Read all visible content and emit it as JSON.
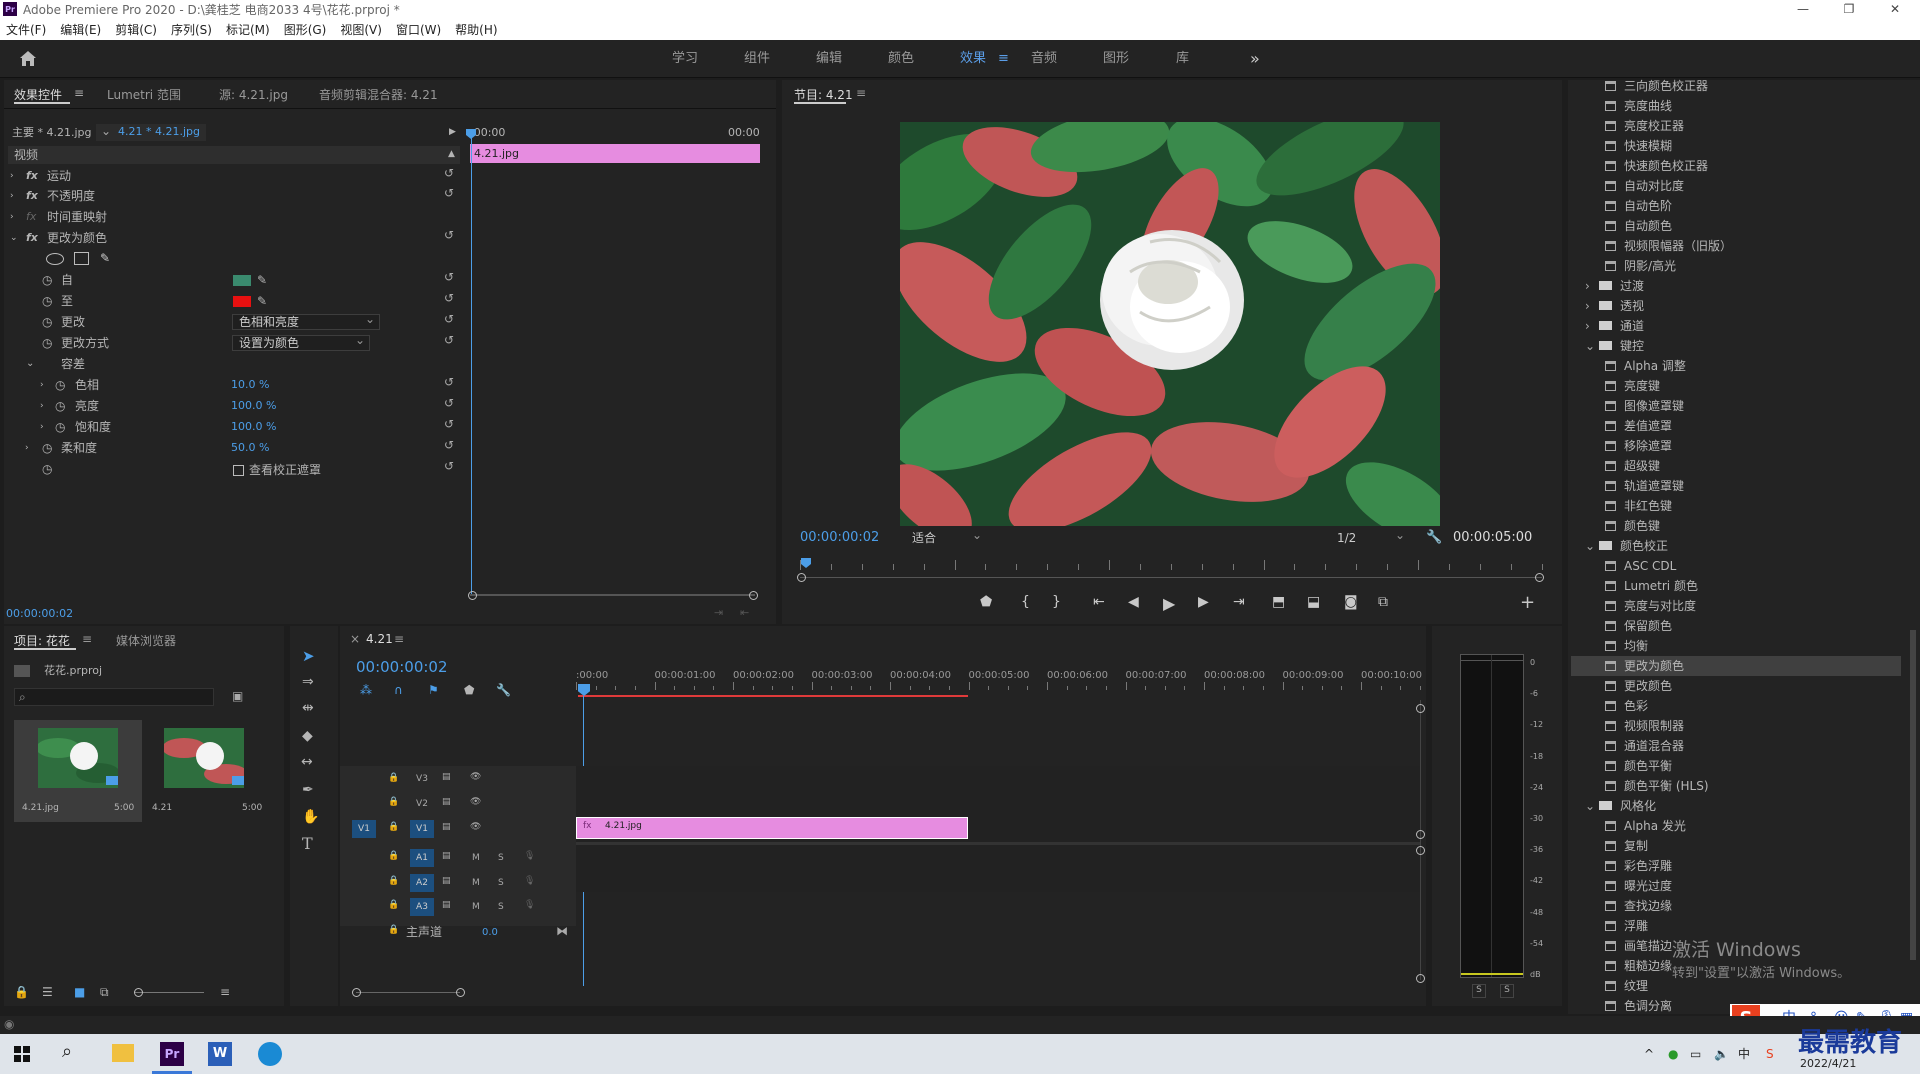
{
  "window": {
    "title": "Adobe Premiere Pro 2020 - D:\\龚桂芝 电商2033 4号\\花花.prproj *",
    "min": "—",
    "max": "❐",
    "close": "✕"
  },
  "menu": [
    "文件(F)",
    "编辑(E)",
    "剪辑(C)",
    "序列(S)",
    "标记(M)",
    "图形(G)",
    "视图(V)",
    "窗口(W)",
    "帮助(H)"
  ],
  "workspaces": [
    "学习",
    "组件",
    "编辑",
    "颜色",
    "效果",
    "音频",
    "图形",
    "库"
  ],
  "active_workspace": "效果",
  "more": "»",
  "effect_controls": {
    "tabs": [
      "效果控件",
      "Lumetri 范围",
      "源: 4.21.jpg",
      "音频剪辑混合器: 4.21"
    ],
    "master": "主要 * 4.21.jpg",
    "clip": "4.21 * 4.21.jpg",
    "ruler_start": ":00:00",
    "ruler_end": "00:00",
    "clip_label": "4.21.jpg",
    "video_header": "视频",
    "fx": [
      "运动",
      "不透明度",
      "时间重映射",
      "更改为颜色"
    ],
    "props": {
      "from": "自",
      "to": "至",
      "change": "更改",
      "change_val": "色相和亮度",
      "by": "更改方式",
      "by_val": "设置为颜色",
      "tolerance": "容差",
      "hue": "色相",
      "hue_val": "10.0 %",
      "light": "亮度",
      "light_val": "100.0 %",
      "sat": "饱和度",
      "sat_val": "100.0 %",
      "soft": "柔和度",
      "soft_val": "50.0 %",
      "mask": "查看校正遮罩"
    },
    "colors": {
      "from": "#3a8a6e",
      "to": "#e81010"
    },
    "timecode": "00:00:00:02"
  },
  "program": {
    "title": "节目: 4.21",
    "timecode": "00:00:00:02",
    "fit": "适合",
    "res": "1/2",
    "duration": "00:00:05:00"
  },
  "project": {
    "tabs": [
      "项目: 花花",
      "媒体浏览器"
    ],
    "file": "花花.prproj",
    "items": [
      {
        "name": "4.21.jpg",
        "dur": "5:00"
      },
      {
        "name": "4.21",
        "dur": "5:00"
      }
    ]
  },
  "timeline": {
    "seq": "4.21",
    "timecode": "00:00:00:02",
    "ruler": [
      ":00:00",
      "00:00:01:00",
      "00:00:02:00",
      "00:00:03:00",
      "00:00:04:00",
      "00:00:05:00",
      "00:00:06:00",
      "00:00:07:00",
      "00:00:08:00",
      "00:00:09:00",
      "00:00:10:00",
      "0"
    ],
    "tracks": [
      "V3",
      "V2",
      "V1",
      "A1",
      "A2",
      "A3"
    ],
    "master": "主声道",
    "master_val": "0.0",
    "clip": "4.21.jpg",
    "m": "M",
    "s": "S"
  },
  "meter": {
    "ticks": [
      "0",
      "-6",
      "-12",
      "-18",
      "-24",
      "-30",
      "-36",
      "-42",
      "-48",
      "-54",
      "dB"
    ],
    "s": "S"
  },
  "effects_list": [
    {
      "t": "i",
      "l": "三向颜色校正器"
    },
    {
      "t": "i",
      "l": "亮度曲线"
    },
    {
      "t": "i",
      "l": "亮度校正器"
    },
    {
      "t": "i",
      "l": "快速模糊"
    },
    {
      "t": "i",
      "l": "快速颜色校正器"
    },
    {
      "t": "i",
      "l": "自动对比度"
    },
    {
      "t": "i",
      "l": "自动色阶"
    },
    {
      "t": "i",
      "l": "自动颜色"
    },
    {
      "t": "i",
      "l": "视频限幅器（旧版）"
    },
    {
      "t": "i",
      "l": "阴影/高光"
    },
    {
      "t": "f",
      "l": "过渡",
      "o": false
    },
    {
      "t": "f",
      "l": "透视",
      "o": false
    },
    {
      "t": "f",
      "l": "通道",
      "o": false
    },
    {
      "t": "f",
      "l": "键控",
      "o": true
    },
    {
      "t": "i",
      "l": "Alpha 调整"
    },
    {
      "t": "i",
      "l": "亮度键"
    },
    {
      "t": "i",
      "l": "图像遮罩键"
    },
    {
      "t": "i",
      "l": "差值遮罩"
    },
    {
      "t": "i",
      "l": "移除遮罩"
    },
    {
      "t": "i",
      "l": "超级键"
    },
    {
      "t": "i",
      "l": "轨道遮罩键"
    },
    {
      "t": "i",
      "l": "非红色键"
    },
    {
      "t": "i",
      "l": "颜色键"
    },
    {
      "t": "f",
      "l": "颜色校正",
      "o": true
    },
    {
      "t": "i",
      "l": "ASC CDL"
    },
    {
      "t": "i",
      "l": "Lumetri 颜色"
    },
    {
      "t": "i",
      "l": "亮度与对比度"
    },
    {
      "t": "i",
      "l": "保留颜色"
    },
    {
      "t": "i",
      "l": "均衡"
    },
    {
      "t": "i",
      "l": "更改为颜色",
      "sel": true
    },
    {
      "t": "i",
      "l": "更改颜色"
    },
    {
      "t": "i",
      "l": "色彩"
    },
    {
      "t": "i",
      "l": "视频限制器"
    },
    {
      "t": "i",
      "l": "通道混合器"
    },
    {
      "t": "i",
      "l": "颜色平衡"
    },
    {
      "t": "i",
      "l": "颜色平衡 (HLS)"
    },
    {
      "t": "f",
      "l": "风格化",
      "o": true
    },
    {
      "t": "i",
      "l": "Alpha 发光"
    },
    {
      "t": "i",
      "l": "复制"
    },
    {
      "t": "i",
      "l": "彩色浮雕"
    },
    {
      "t": "i",
      "l": "曝光过度"
    },
    {
      "t": "i",
      "l": "查找边缘"
    },
    {
      "t": "i",
      "l": "浮雕"
    },
    {
      "t": "i",
      "l": "画笔描边"
    },
    {
      "t": "i",
      "l": "粗糙边缘"
    },
    {
      "t": "i",
      "l": "纹理"
    },
    {
      "t": "i",
      "l": "色调分离"
    }
  ],
  "watermark": {
    "line1": "激活 Windows",
    "line2": "转到\"设置\"以激活 Windows。"
  },
  "brand": "最需教育",
  "ime": "中",
  "date": "2022/4/21",
  "accent": "#4c9ee8",
  "clip_color": "#e68ce0"
}
